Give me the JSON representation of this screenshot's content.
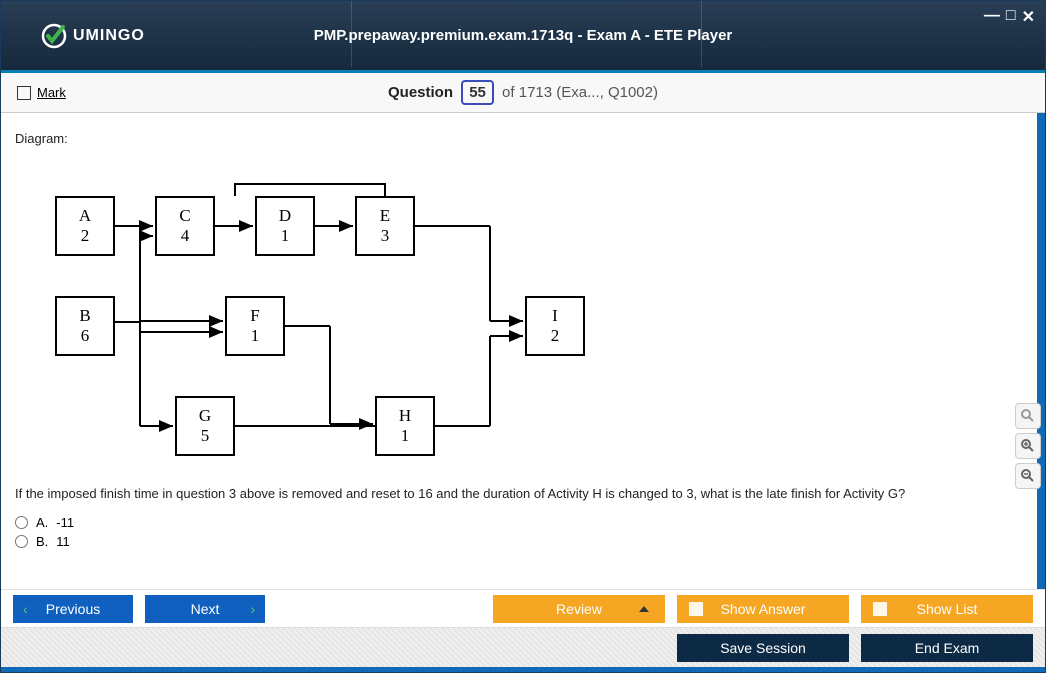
{
  "header": {
    "logo_text": "UMINGO",
    "title": "PMP.prepaway.premium.exam.1713q - Exam A - ETE Player"
  },
  "question_bar": {
    "mark_label": "Mark",
    "question_label": "Question",
    "question_number": "55",
    "of_text": "of 1713 (Exa..., Q1002)"
  },
  "content": {
    "diagram_label": "Diagram:",
    "nodes": {
      "A": {
        "name": "A",
        "val": "2"
      },
      "B": {
        "name": "B",
        "val": "6"
      },
      "C": {
        "name": "C",
        "val": "4"
      },
      "D": {
        "name": "D",
        "val": "1"
      },
      "E": {
        "name": "E",
        "val": "3"
      },
      "F": {
        "name": "F",
        "val": "1"
      },
      "G": {
        "name": "G",
        "val": "5"
      },
      "H": {
        "name": "H",
        "val": "1"
      },
      "I": {
        "name": "I",
        "val": "2"
      }
    },
    "question_text": "If the imposed finish time in question 3 above is removed and reset to 16 and the duration of Activity H is changed to 3, what is the late finish for Activity G?",
    "answers": [
      {
        "letter": "A.",
        "text": "-11"
      },
      {
        "letter": "B.",
        "text": "11"
      }
    ]
  },
  "buttons": {
    "previous": "Previous",
    "next": "Next",
    "review": "Review",
    "show_answer": "Show Answer",
    "show_list": "Show List",
    "save_session": "Save Session",
    "end_exam": "End Exam"
  }
}
